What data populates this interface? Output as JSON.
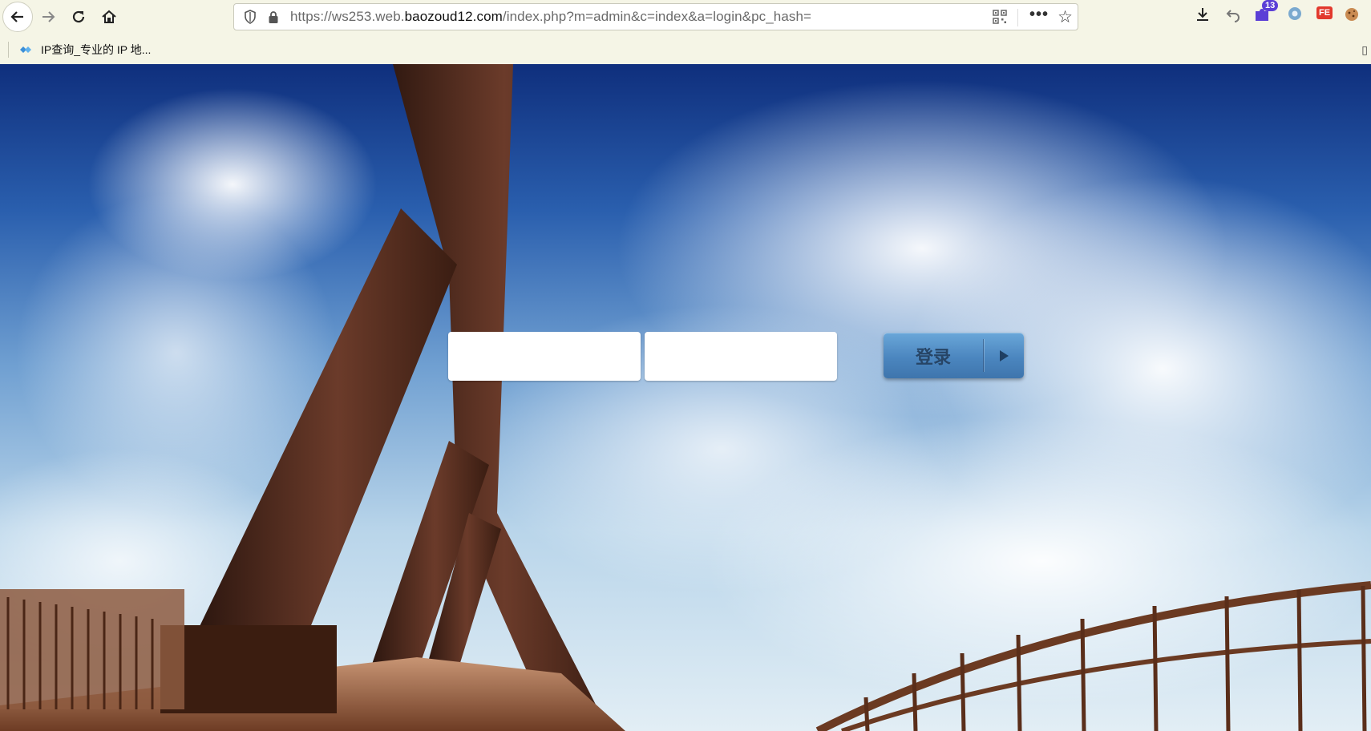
{
  "browser": {
    "url_prefix": "https://ws253.web.",
    "url_host": "baozoud12.com",
    "url_path": "/index.php?m=admin&c=index&a=login&pc_hash=",
    "more_label": "•••",
    "extension_badge_count": "13",
    "fe_extension_label": "FE",
    "bookmarks": [
      {
        "label": "IP查询_专业的 IP 地..."
      }
    ]
  },
  "login": {
    "username_value": "",
    "password_value": "",
    "submit_label": "登录"
  },
  "colors": {
    "button_accent": "#4b86bf",
    "sky_top": "#0f2f7d",
    "sky_bottom": "#e2eef5"
  },
  "icons": {
    "back": "arrow-left-icon",
    "forward": "arrow-right-icon",
    "reload": "reload-icon",
    "home": "home-icon",
    "shield": "shield-icon",
    "lock": "lock-icon",
    "qr": "qr-code-icon",
    "star": "star-icon",
    "download": "download-icon",
    "undo": "undo-icon",
    "mobile": "mobile-icon",
    "submit_arrow": "play-arrow-icon"
  }
}
